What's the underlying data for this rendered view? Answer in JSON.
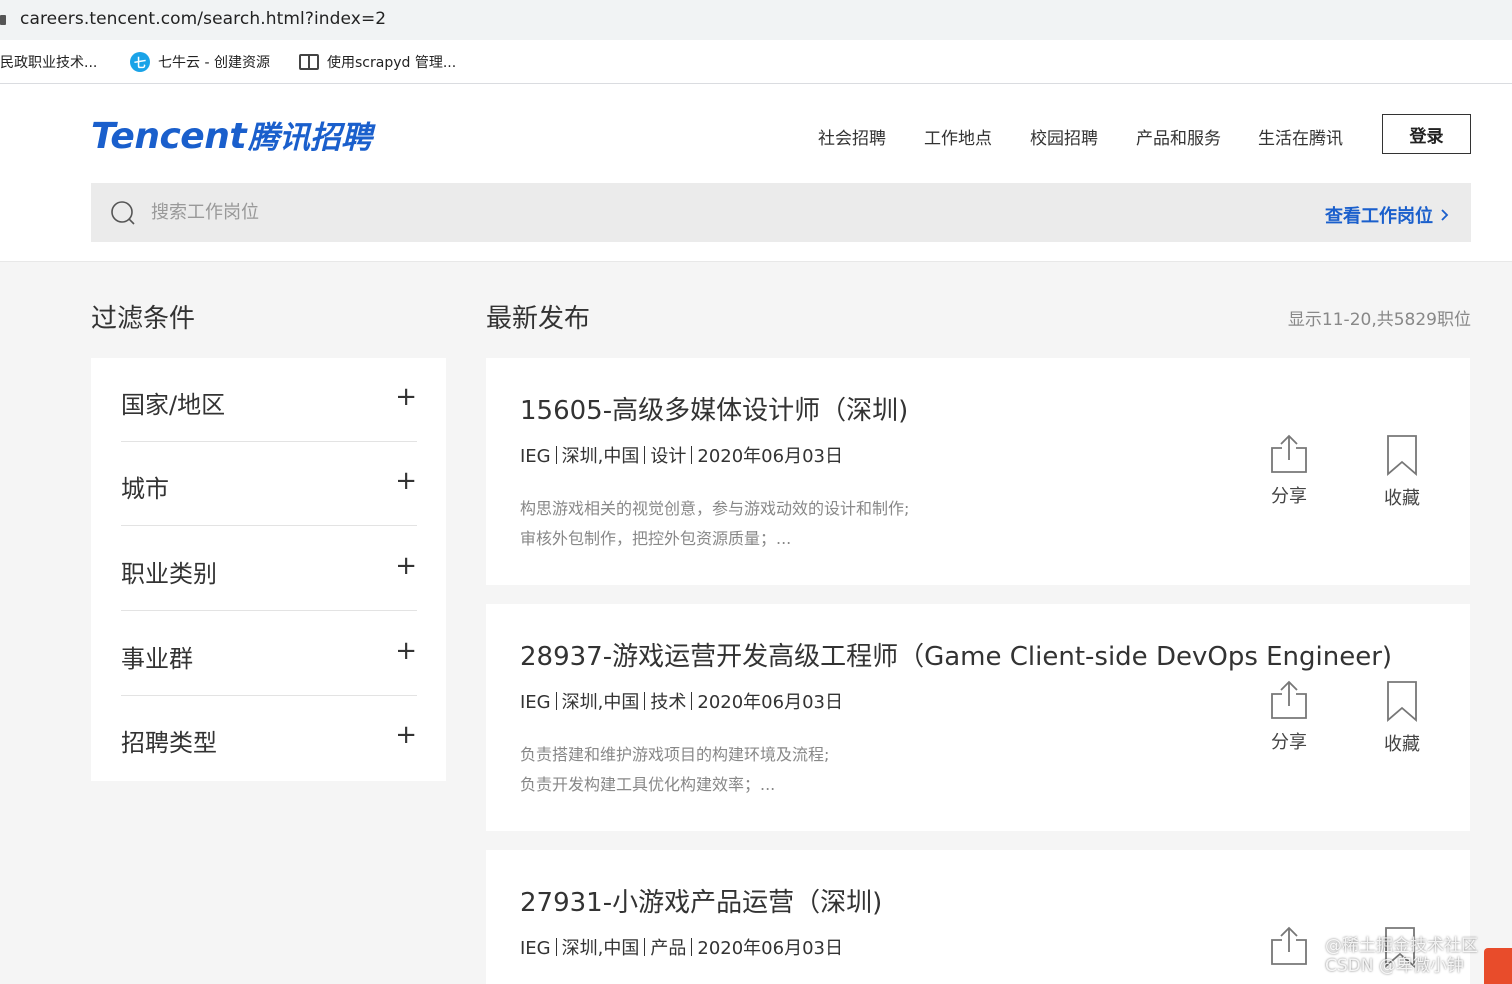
{
  "browser": {
    "url": "careers.tencent.com/search.html?index=2",
    "bookmarks": [
      {
        "label": "民政职业技术..."
      },
      {
        "label": "七牛云 - 创建资源",
        "icon": "qiniu-icon"
      },
      {
        "label": "使用scrapyd 管理...",
        "icon": "book-icon"
      }
    ]
  },
  "header": {
    "logo_en": "Tencent",
    "logo_cn": "腾讯招聘",
    "nav": [
      "社会招聘",
      "工作地点",
      "校园招聘",
      "产品和服务",
      "生活在腾讯"
    ],
    "login_label": "登录"
  },
  "search": {
    "placeholder": "搜索工作岗位",
    "link_label": "查看工作岗位"
  },
  "filters": {
    "title": "过滤条件",
    "items": [
      "国家/地区",
      "城市",
      "职业类别",
      "事业群",
      "招聘类型"
    ],
    "expand_symbol": "+"
  },
  "results": {
    "title": "最新发布",
    "count": "显示11-20,共5829职位",
    "share_label": "分享",
    "favorite_label": "收藏",
    "jobs": [
      {
        "title": "15605-高级多媒体设计师（深圳)",
        "bg": "IEG",
        "location": "深圳,中国",
        "category": "设计",
        "date": "2020年06月03日",
        "desc1": "构思游戏相关的视觉创意，参与游戏动效的设计和制作;",
        "desc2": "审核外包制作，把控外包资源质量；..."
      },
      {
        "title": "28937-游戏运营开发高级工程师（Game Client-side DevOps Engineer)",
        "bg": "IEG",
        "location": "深圳,中国",
        "category": "技术",
        "date": "2020年06月03日",
        "desc1": "负责搭建和维护游戏项目的构建环境及流程;",
        "desc2": "负责开发构建工具优化构建效率；..."
      },
      {
        "title": "27931-小游戏产品运营（深圳)",
        "bg": "IEG",
        "location": "深圳,中国",
        "category": "产品",
        "date": "2020年06月03日",
        "desc1": "",
        "desc2": ""
      }
    ]
  },
  "watermark": {
    "line1": "@稀土掘金技术社区",
    "line2": "CSDN @卑微小钟"
  },
  "colors": {
    "brand": "#1a5fcc",
    "page_bg": "#f5f5f5",
    "search_bg": "#ebebeb"
  }
}
